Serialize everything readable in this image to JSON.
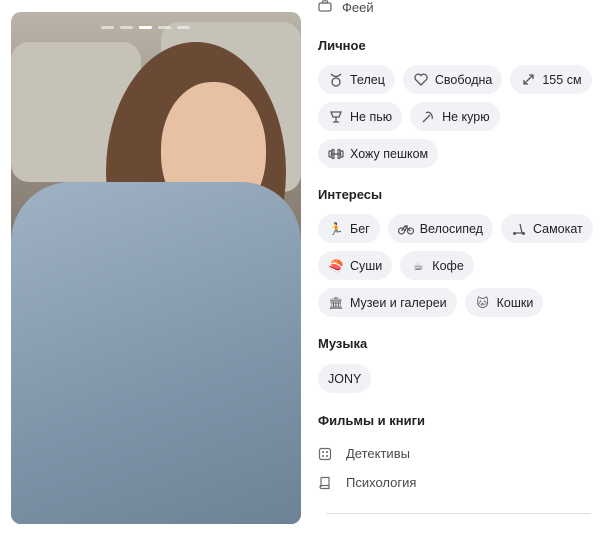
{
  "top": {
    "label": "Феей",
    "icon": "briefcase-icon"
  },
  "personal": {
    "title": "Личное",
    "chips": [
      {
        "icon": "zodiac-icon",
        "label": "Телец"
      },
      {
        "icon": "heart-icon",
        "label": "Свободна"
      },
      {
        "icon": "height-icon",
        "label": "155 см"
      },
      {
        "icon": "drink-icon",
        "label": "Не пью"
      },
      {
        "icon": "no-smoking-icon",
        "label": "Не курю"
      },
      {
        "icon": "dumbbell-icon",
        "label": "Хожу пешком"
      }
    ]
  },
  "interests": {
    "title": "Интересы",
    "chips": [
      {
        "icon": "running-emoji",
        "label": "Бег"
      },
      {
        "icon": "bicycle-icon",
        "label": "Велосипед"
      },
      {
        "icon": "scooter-icon",
        "label": "Самокат"
      },
      {
        "icon": "sushi-emoji",
        "label": "Суши"
      },
      {
        "icon": "coffee-emoji",
        "label": "Кофе"
      },
      {
        "icon": "museum-emoji",
        "label": "Музеи и галереи"
      },
      {
        "icon": "cat-emoji",
        "label": "Кошки"
      }
    ]
  },
  "music": {
    "title": "Музыка",
    "chips": [
      {
        "label": "JONY"
      }
    ]
  },
  "films_books": {
    "title": "Фильмы и книги",
    "items": [
      {
        "icon": "dice-icon",
        "label": "Детективы"
      },
      {
        "icon": "book-icon",
        "label": "Психология"
      }
    ]
  },
  "photo": {
    "pages": 5,
    "active": 2
  }
}
